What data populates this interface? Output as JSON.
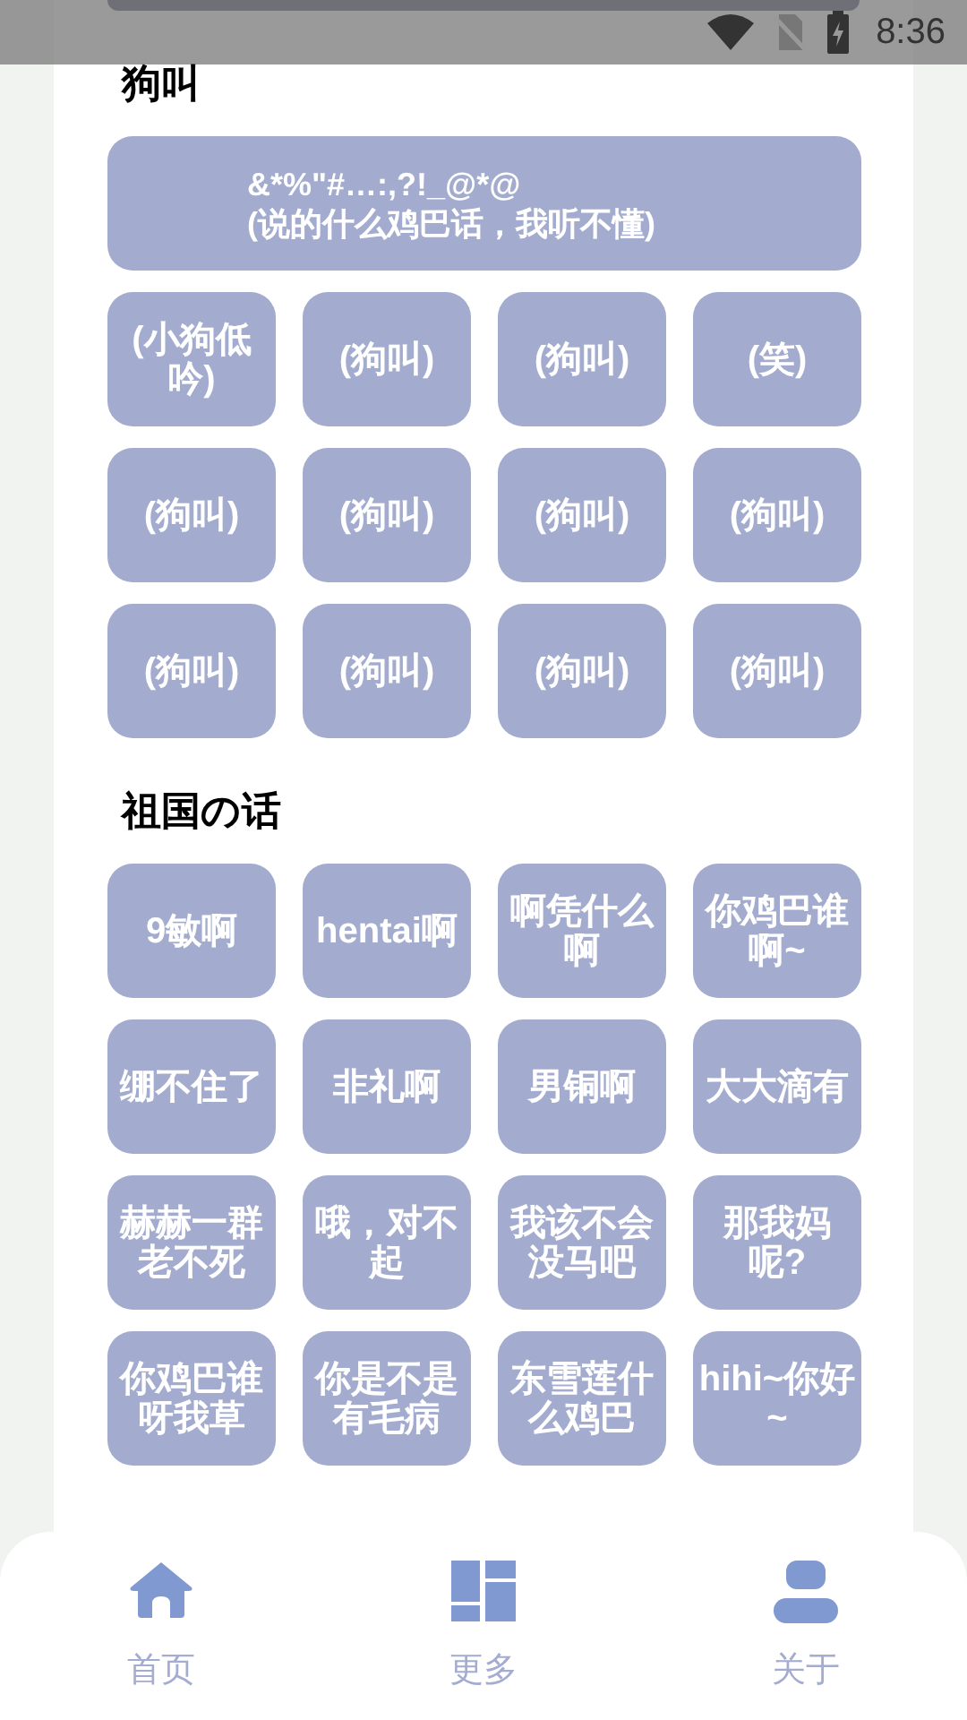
{
  "status_bar": {
    "time": "8:36"
  },
  "sections": [
    {
      "title": "狗叫",
      "items": [
        {
          "kind": "wide",
          "label": "&*%\"#…:,?!_@*@\n(说的什么鸡巴话，我听不懂)"
        },
        {
          "kind": "tile",
          "label": "(小狗低吟)"
        },
        {
          "kind": "tile",
          "label": "(狗叫)"
        },
        {
          "kind": "tile",
          "label": "(狗叫)"
        },
        {
          "kind": "tile",
          "label": "(笑)"
        },
        {
          "kind": "tile",
          "label": "(狗叫)"
        },
        {
          "kind": "tile",
          "label": "(狗叫)"
        },
        {
          "kind": "tile",
          "label": "(狗叫)"
        },
        {
          "kind": "tile",
          "label": "(狗叫)"
        },
        {
          "kind": "tile",
          "label": "(狗叫)"
        },
        {
          "kind": "tile",
          "label": "(狗叫)"
        },
        {
          "kind": "tile",
          "label": "(狗叫)"
        },
        {
          "kind": "tile",
          "label": "(狗叫)"
        }
      ]
    },
    {
      "title": "祖国の话",
      "items": [
        {
          "kind": "tile",
          "label": "9敏啊"
        },
        {
          "kind": "tile",
          "label": "hentai啊"
        },
        {
          "kind": "tile",
          "label": "啊凭什么啊"
        },
        {
          "kind": "tile",
          "label": "你鸡巴谁啊~"
        },
        {
          "kind": "tile",
          "label": "绷不住了"
        },
        {
          "kind": "tile",
          "label": "非礼啊"
        },
        {
          "kind": "tile",
          "label": "男铜啊"
        },
        {
          "kind": "tile",
          "label": "大大滴有"
        },
        {
          "kind": "tile",
          "label": "赫赫一群老不死"
        },
        {
          "kind": "tile",
          "label": "哦，对不起"
        },
        {
          "kind": "tile",
          "label": "我该不会没马吧"
        },
        {
          "kind": "tile",
          "label": "那我妈呢?"
        },
        {
          "kind": "tile",
          "label": "你鸡巴谁呀我草"
        },
        {
          "kind": "tile",
          "label": "你是不是有毛病"
        },
        {
          "kind": "tile",
          "label": "东雪莲什么鸡巴"
        },
        {
          "kind": "tile",
          "label": "hihi~你好~"
        }
      ]
    }
  ],
  "nav": [
    {
      "kind": "home",
      "label": "首页"
    },
    {
      "kind": "grid",
      "label": "更多"
    },
    {
      "kind": "person",
      "label": "关于"
    }
  ]
}
